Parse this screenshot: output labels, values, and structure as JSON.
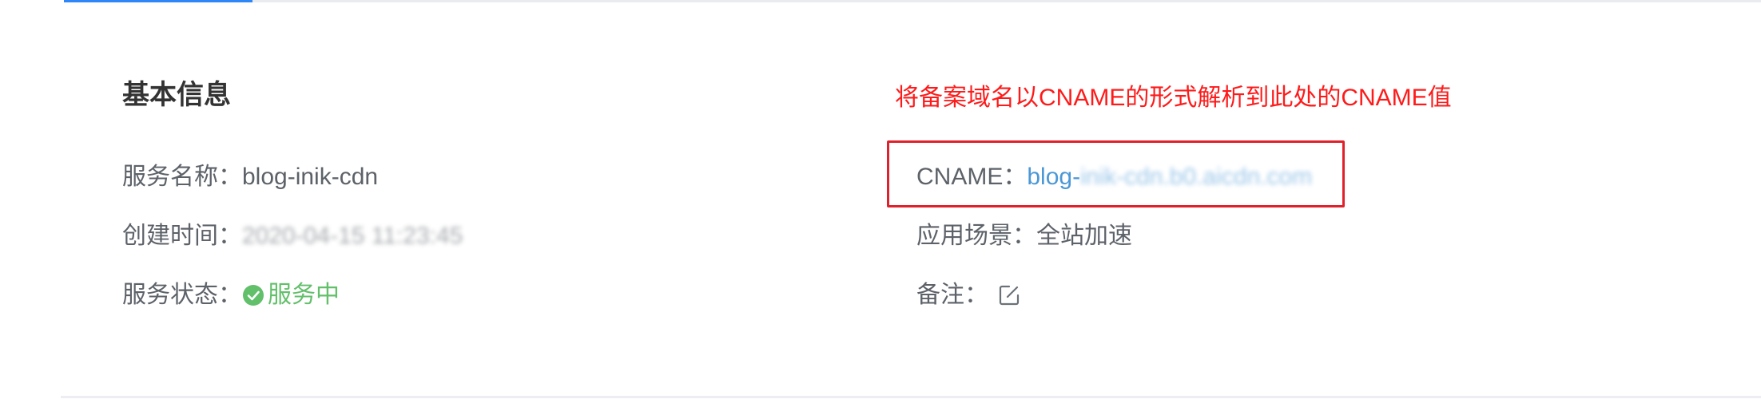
{
  "section": {
    "title": "基本信息"
  },
  "annotation": {
    "text": "将备案域名以CNAME的形式解析到此处的CNAME值",
    "color": "#ff1a1a"
  },
  "left": {
    "service_name": {
      "label": "服务名称：",
      "value": "blog-inik-cdn"
    },
    "created_time": {
      "label": "创建时间：",
      "value": "2020-04-15 11:23:45"
    },
    "service_status": {
      "label": "服务状态：",
      "value": "服务中",
      "icon": "check-circle-icon",
      "color": "#62bf6a"
    }
  },
  "right": {
    "cname": {
      "label": "CNAME：",
      "value_prefix": "blog-",
      "value_rest": "inik-cdn.b0.aicdn.com"
    },
    "scenario": {
      "label": "应用场景：",
      "value": "全站加速"
    },
    "remark": {
      "label": "备注：",
      "icon": "edit-icon"
    }
  },
  "colors": {
    "accent": "#2f86f6",
    "link": "#4b98d6",
    "highlight_border": "#e0212b"
  }
}
